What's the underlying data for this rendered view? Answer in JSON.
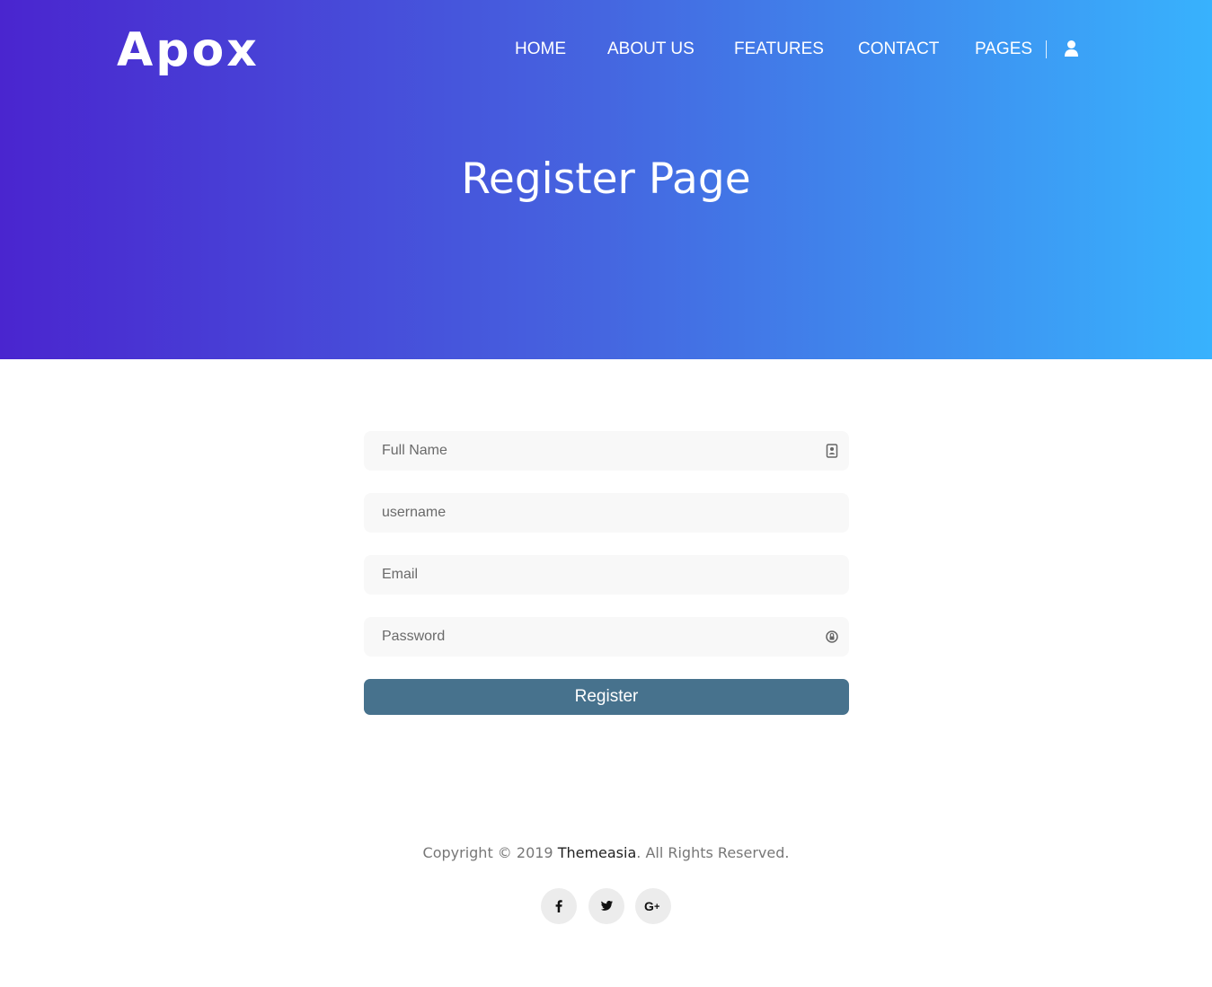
{
  "brand": {
    "logo_text": "Apox"
  },
  "nav": {
    "items": [
      {
        "label": "HOME"
      },
      {
        "label": "ABOUT US"
      },
      {
        "label": "FEATURES"
      },
      {
        "label": "CONTACT"
      },
      {
        "label": "PAGES"
      }
    ],
    "user_icon": "user-icon"
  },
  "hero": {
    "title": "Register Page",
    "gradient_start": "#4a25cf",
    "gradient_end": "#38b2fd"
  },
  "form": {
    "full_name": {
      "placeholder": "Full Name",
      "value": "",
      "icon": "contact-card-icon"
    },
    "username": {
      "placeholder": "username",
      "value": ""
    },
    "email": {
      "placeholder": "Email",
      "value": ""
    },
    "password": {
      "placeholder": "Password",
      "value": "",
      "icon": "lock-icon"
    },
    "submit_label": "Register",
    "button_color": "#47728d"
  },
  "footer": {
    "copyright_prefix": "Copyright © 2019 ",
    "company": "Themeasia",
    "copyright_suffix": ". All Rights Reserved.",
    "socials": [
      {
        "name": "facebook-icon",
        "glyph": "f"
      },
      {
        "name": "twitter-icon",
        "glyph": "🐦"
      },
      {
        "name": "google-plus-icon",
        "glyph": "G+"
      }
    ]
  }
}
